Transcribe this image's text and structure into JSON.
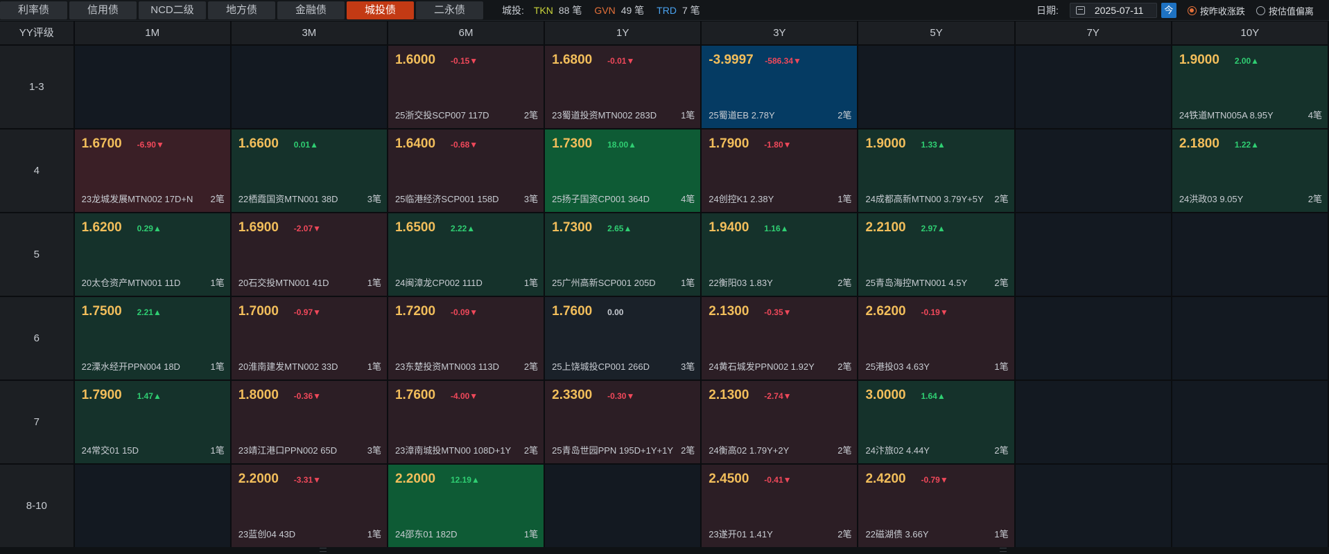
{
  "tabs": [
    {
      "label": "利率债",
      "active": false
    },
    {
      "label": "信用债",
      "active": false
    },
    {
      "label": "NCD二级",
      "active": false
    },
    {
      "label": "地方债",
      "active": false
    },
    {
      "label": "金融债",
      "active": false
    },
    {
      "label": "城投债",
      "active": true
    },
    {
      "label": "二永债",
      "active": false
    }
  ],
  "counts": {
    "label": "城投:",
    "items": [
      {
        "code": "TKN",
        "count": "88 笔",
        "color": "#c9d43a"
      },
      {
        "code": "GVN",
        "count": "49 笔",
        "color": "#e5713a"
      },
      {
        "code": "TRD",
        "count": "7 笔",
        "color": "#4aa3f0"
      }
    ]
  },
  "date": {
    "label": "日期:",
    "value": "2025-07-11",
    "today_button": "今"
  },
  "radios": [
    {
      "label": "按昨收涨跌",
      "selected": true
    },
    {
      "label": "按估值偏离",
      "selected": false
    }
  ],
  "table": {
    "corner": "YY评级",
    "columns": [
      "1M",
      "3M",
      "6M",
      "1Y",
      "3Y",
      "5Y",
      "7Y",
      "10Y"
    ],
    "rows": [
      {
        "label": "1-3",
        "cells": [
          null,
          null,
          {
            "rate": "1.6000",
            "change": "-0.15▼",
            "bond": "25浙交投SCP007 117D",
            "trades": "2笔",
            "tone": "dn"
          },
          {
            "rate": "1.6800",
            "change": "-0.01▼",
            "bond": "23蜀道投资MTN002 283D",
            "trades": "1笔",
            "tone": "dn"
          },
          {
            "rate": "-3.9997",
            "change": "-586.34▼",
            "bond": "25蜀道EB 2.78Y",
            "trades": "2笔",
            "tone": "blue"
          },
          null,
          null,
          {
            "rate": "1.9000",
            "change": "2.00▲",
            "bond": "24铁道MTN005A 8.95Y",
            "trades": "4笔",
            "tone": "up"
          }
        ]
      },
      {
        "label": "4",
        "cells": [
          {
            "rate": "1.6700",
            "change": "-6.90▼",
            "bond": "23龙城发展MTN002 17D+N",
            "trades": "2笔",
            "tone": "dn-strong"
          },
          {
            "rate": "1.6600",
            "change": "0.01▲",
            "bond": "22栖霞国资MTN001 38D",
            "trades": "3笔",
            "tone": "up"
          },
          {
            "rate": "1.6400",
            "change": "-0.68▼",
            "bond": "25临港经济SCP001 158D",
            "trades": "3笔",
            "tone": "dn"
          },
          {
            "rate": "1.7300",
            "change": "18.00▲",
            "bond": "25扬子国资CP001 364D",
            "trades": "4笔",
            "tone": "up-strong"
          },
          {
            "rate": "1.7900",
            "change": "-1.80▼",
            "bond": "24创控K1 2.38Y",
            "trades": "1笔",
            "tone": "dn"
          },
          {
            "rate": "1.9000",
            "change": "1.33▲",
            "bond": "24成都高新MTN00 3.79Y+5Y",
            "trades": "2笔",
            "tone": "up"
          },
          null,
          {
            "rate": "2.1800",
            "change": "1.22▲",
            "bond": "24洪政03 9.05Y",
            "trades": "2笔",
            "tone": "up"
          }
        ]
      },
      {
        "label": "5",
        "cells": [
          {
            "rate": "1.6200",
            "change": "0.29▲",
            "bond": "20太仓资产MTN001 11D",
            "trades": "1笔",
            "tone": "up"
          },
          {
            "rate": "1.6900",
            "change": "-2.07▼",
            "bond": "20石交投MTN001 41D",
            "trades": "1笔",
            "tone": "dn"
          },
          {
            "rate": "1.6500",
            "change": "2.22▲",
            "bond": "24闽漳龙CP002 111D",
            "trades": "1笔",
            "tone": "up"
          },
          {
            "rate": "1.7300",
            "change": "2.65▲",
            "bond": "25广州高新SCP001 205D",
            "trades": "1笔",
            "tone": "up"
          },
          {
            "rate": "1.9400",
            "change": "1.16▲",
            "bond": "22衡阳03 1.83Y",
            "trades": "2笔",
            "tone": "up"
          },
          {
            "rate": "2.2100",
            "change": "2.97▲",
            "bond": "25青岛海控MTN001 4.5Y",
            "trades": "2笔",
            "tone": "up"
          },
          null,
          null
        ]
      },
      {
        "label": "6",
        "cells": [
          {
            "rate": "1.7500",
            "change": "2.21▲",
            "bond": "22溧水经开PPN004 18D",
            "trades": "1笔",
            "tone": "up"
          },
          {
            "rate": "1.7000",
            "change": "-0.97▼",
            "bond": "20淮南建发MTN002 33D",
            "trades": "1笔",
            "tone": "dn"
          },
          {
            "rate": "1.7200",
            "change": "-0.09▼",
            "bond": "23东楚投资MTN003 113D",
            "trades": "2笔",
            "tone": "dn"
          },
          {
            "rate": "1.7600",
            "change": "0.00",
            "bond": "25上饶城投CP001 266D",
            "trades": "3笔",
            "tone": "flat"
          },
          {
            "rate": "2.1300",
            "change": "-0.35▼",
            "bond": "24黄石城发PPN002 1.92Y",
            "trades": "2笔",
            "tone": "dn"
          },
          {
            "rate": "2.6200",
            "change": "-0.19▼",
            "bond": "25港投03 4.63Y",
            "trades": "1笔",
            "tone": "dn"
          },
          null,
          null
        ]
      },
      {
        "label": "7",
        "cells": [
          {
            "rate": "1.7900",
            "change": "1.47▲",
            "bond": "24常交01 15D",
            "trades": "1笔",
            "tone": "up"
          },
          {
            "rate": "1.8000",
            "change": "-0.36▼",
            "bond": "23靖江港口PPN002 65D",
            "trades": "3笔",
            "tone": "dn"
          },
          {
            "rate": "1.7600",
            "change": "-4.00▼",
            "bond": "23漳南城投MTN00 108D+1Y",
            "trades": "2笔",
            "tone": "dn"
          },
          {
            "rate": "2.3300",
            "change": "-0.30▼",
            "bond": "25青岛世园PPN 195D+1Y+1Y",
            "trades": "2笔",
            "tone": "dn"
          },
          {
            "rate": "2.1300",
            "change": "-2.74▼",
            "bond": "24衡高02 1.79Y+2Y",
            "trades": "2笔",
            "tone": "dn"
          },
          {
            "rate": "3.0000",
            "change": "1.64▲",
            "bond": "24汴旅02 4.44Y",
            "trades": "2笔",
            "tone": "up"
          },
          null,
          null
        ]
      },
      {
        "label": "8-10",
        "cells": [
          null,
          {
            "rate": "2.2000",
            "change": "-3.31▼",
            "bond": "23蓝创04 43D",
            "trades": "1笔",
            "tone": "dn"
          },
          {
            "rate": "2.2000",
            "change": "12.19▲",
            "bond": "24邵东01 182D",
            "trades": "1笔",
            "tone": "up-strong"
          },
          null,
          {
            "rate": "2.4500",
            "change": "-0.41▼",
            "bond": "23遂开01 1.41Y",
            "trades": "2笔",
            "tone": "dn"
          },
          {
            "rate": "2.4200",
            "change": "-0.79▼",
            "bond": "22磁湖债 3.66Y",
            "trades": "1笔",
            "tone": "dn"
          },
          null,
          null
        ]
      }
    ]
  }
}
